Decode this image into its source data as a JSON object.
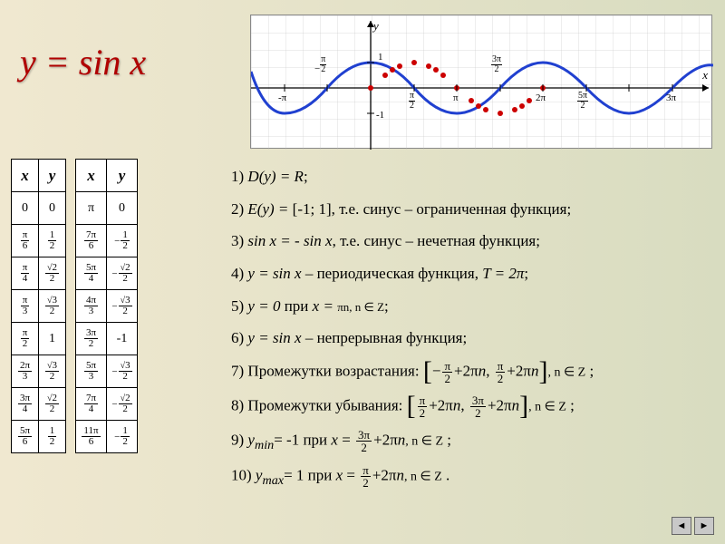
{
  "title": "y = sin x",
  "tableA": {
    "hx": "x",
    "hy": "y",
    "rows": [
      [
        "0",
        "0"
      ],
      [
        "π/6",
        "1/2"
      ],
      [
        "π/4",
        "√2/2"
      ],
      [
        "π/3",
        "√3/2"
      ],
      [
        "π/2",
        "1"
      ],
      [
        "2π/3",
        "√3/2"
      ],
      [
        "3π/4",
        "√2/2"
      ],
      [
        "5π/6",
        "1/2"
      ]
    ]
  },
  "tableB": {
    "hx": "x",
    "hy": "y",
    "rows": [
      [
        "π",
        "0"
      ],
      [
        "7π/6",
        "−1/2"
      ],
      [
        "5π/4",
        "−√2/2"
      ],
      [
        "4π/3",
        "−√3/2"
      ],
      [
        "3π/2",
        "-1"
      ],
      [
        "5π/3",
        "−√3/2"
      ],
      [
        "7π/4",
        "−√2/2"
      ],
      [
        "11π/6",
        "−1/2"
      ]
    ]
  },
  "props": {
    "p1a": "1) ",
    "p1b": "D(y) = R",
    "p1c": ";",
    "p2a": "2) ",
    "p2b": "E(y) = ",
    "p2c": "[-1; 1]",
    "p2d": ", т.е. синус – ограниченная функция;",
    "p3a": "3) ",
    "p3b": "sin x = - sin x",
    "p3c": ", т.е. синус – нечетная функция;",
    "p4a": "4) ",
    "p4b": "y = sin x",
    "p4c": " – периодическая функция, ",
    "p4d": "T = 2π",
    "p4e": ";",
    "p5a": "5) ",
    "p5b": "y = 0",
    "p5c": " при ",
    "p5d": "x = ",
    "p5e": "πn, n ∈ Z",
    "p5f": ";",
    "p6a": "6) ",
    "p6b": "y = sin x",
    "p6c": " – непрерывная функция;",
    "p7": "7) Промежутки возрастания: ",
    "p8": "8) Промежутки убывания: ",
    "p9a": "9) ",
    "p9b": "y",
    "p9c": "min",
    "p9d": "= -1 при ",
    "p9e": " ;",
    "p10a": "10) ",
    "p10b": "y",
    "p10c": "max",
    "p10d": "= 1 при ",
    "p10e": " .",
    "interval_tail": ", n ∈ Z"
  },
  "graph": {
    "ylabel": "y",
    "xlabel": "x",
    "y1": "1",
    "ym1": "-1",
    "ticks": [
      "-π",
      "π",
      "2π",
      "3π"
    ],
    "fracs": [
      "π/2",
      "3π/2",
      "5π/2"
    ],
    "neg_frac": "π/2"
  },
  "chart_data": {
    "type": "line",
    "title": "y = sin x",
    "xlabel": "x",
    "ylabel": "y",
    "xlim": [
      -3.5,
      10
    ],
    "ylim": [
      -1.2,
      1.2
    ],
    "x_ticks": [
      -3.1416,
      -1.5708,
      1.5708,
      3.1416,
      4.7124,
      6.2832,
      7.854,
      9.4248
    ],
    "x_tick_labels": [
      "-π",
      "-π/2",
      "π/2",
      "π",
      "3π/2",
      "2π",
      "5π/2",
      "3π"
    ],
    "y_ticks": [
      -1,
      1
    ],
    "y_tick_labels": [
      "-1",
      "1"
    ],
    "series": [
      {
        "name": "sin x",
        "x": [
          -3.5,
          -3.1416,
          -2.5,
          -1.5708,
          -0.8,
          0,
          0.5236,
          1.0472,
          1.5708,
          2.0944,
          2.618,
          3.1416,
          3.665,
          4.1888,
          4.7124,
          5.236,
          5.7596,
          6.2832,
          7,
          7.854,
          8.5,
          9.4248,
          10
        ],
        "y": [
          0.35,
          0,
          -0.6,
          -1,
          -0.72,
          0,
          0.5,
          0.87,
          1,
          0.87,
          0.5,
          0,
          -0.5,
          -0.87,
          -1,
          -0.87,
          -0.5,
          0,
          0.66,
          1,
          0.8,
          0,
          -0.54
        ]
      }
    ],
    "markers": {
      "x": [
        0,
        0.5236,
        0.7854,
        1.0472,
        1.5708,
        2.0944,
        2.3562,
        2.618,
        3.1416,
        3.665,
        3.927,
        4.1888,
        4.7124,
        5.236,
        5.4978,
        5.7596,
        6.2832
      ],
      "y": [
        0,
        0.5,
        0.71,
        0.87,
        1,
        0.87,
        0.71,
        0.5,
        0,
        -0.5,
        -0.71,
        -0.87,
        -1,
        -0.87,
        -0.71,
        -0.5,
        0
      ]
    }
  }
}
